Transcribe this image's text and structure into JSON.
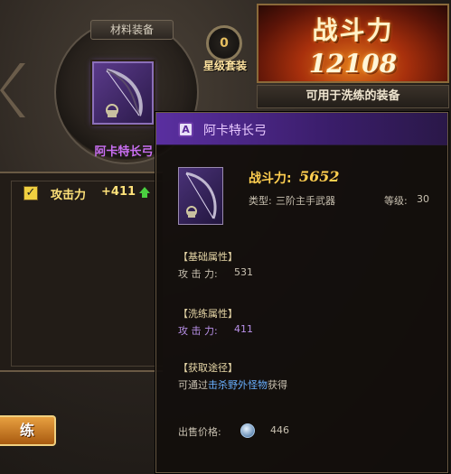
{
  "material": {
    "title": "材料装备",
    "item_name": "阿卡特长弓",
    "star_count": "0",
    "star_label": "星级套装"
  },
  "power_panel": {
    "title": "战斗力",
    "value": "12108",
    "refine_label": "可用于洗练的装备"
  },
  "attributes": [
    {
      "checked": true,
      "label": "攻击力",
      "value": "+411",
      "trend": "up"
    }
  ],
  "refine_button": "练",
  "tooltip": {
    "grade": "A",
    "name": "阿卡特长弓",
    "power_label": "战斗力:",
    "power_value": "5652",
    "type_label": "类型:",
    "type_value": "三阶主手武器",
    "level_label": "等级:",
    "level_value": "30",
    "base_title": "【基础属性】",
    "base_attr_label": "攻 击 力:",
    "base_attr_value": "531",
    "refine_title": "【洗练属性】",
    "refine_attr_label": "攻 击 力:",
    "refine_attr_value": "411",
    "source_title": "【获取途径】",
    "source_prefix": "可通过",
    "source_link": "击杀野外怪物",
    "source_suffix": "获得",
    "price_label": "出售价格:",
    "price_value": "446"
  },
  "colors": {
    "purple_quality": "#c86ef0",
    "gold_text": "#ffcf50",
    "link_blue": "#6ab0ff"
  }
}
